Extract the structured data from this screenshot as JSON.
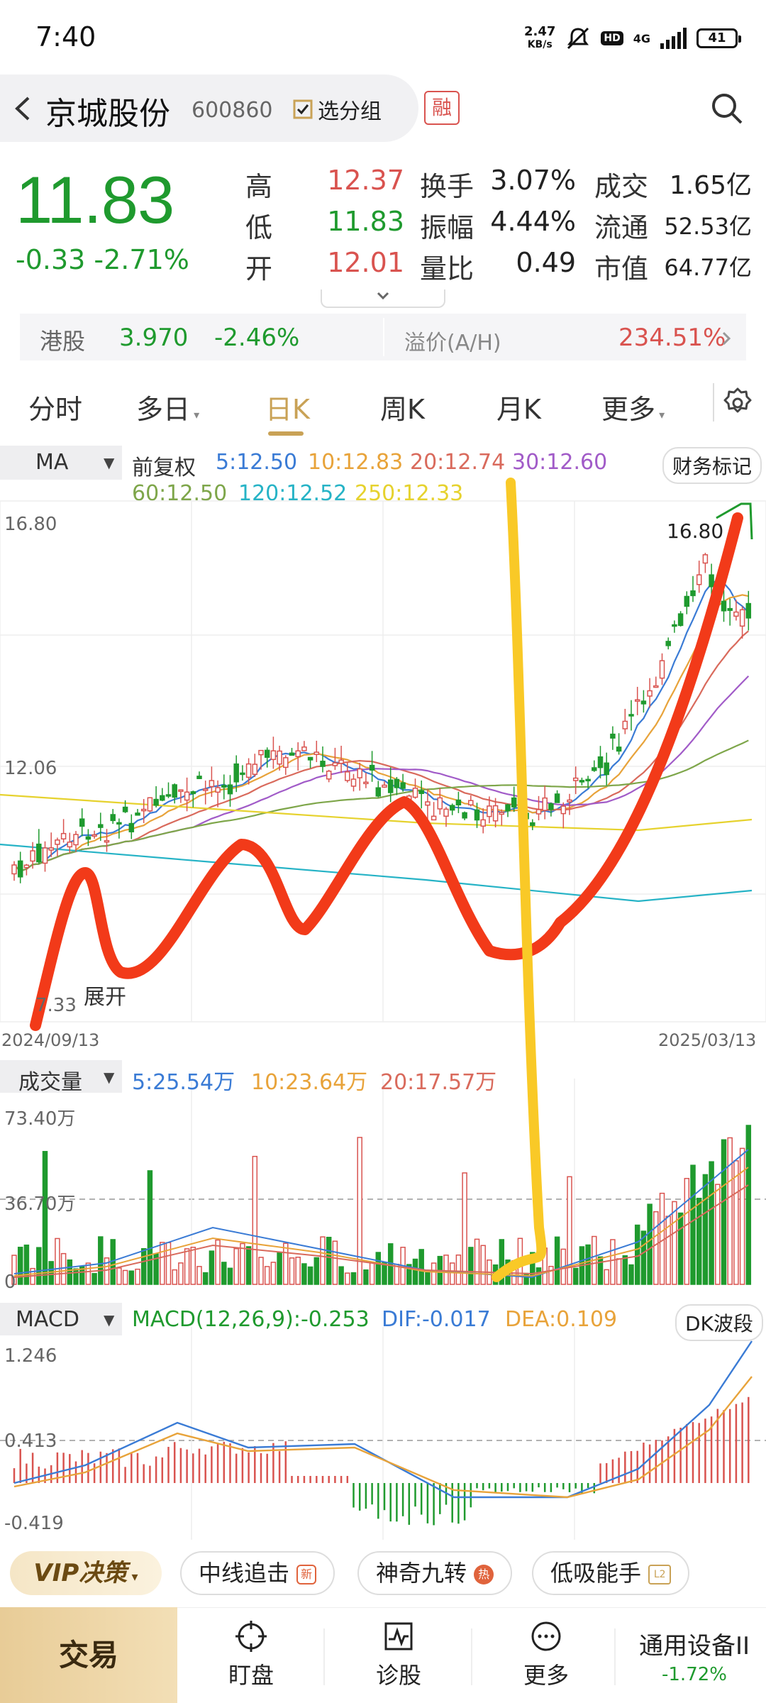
{
  "status_bar": {
    "time": "7:40",
    "net_speed_value": "2.47",
    "net_speed_unit": "KB/s",
    "network": "4G",
    "battery": "41"
  },
  "header": {
    "stock_name": "京城股份",
    "stock_code": "600860",
    "watch_label": "选分组",
    "margin_badge": "融"
  },
  "quote": {
    "price": "11.83",
    "change": "-0.33",
    "change_pct": "-2.71%",
    "high_label": "高",
    "high": "12.37",
    "low_label": "低",
    "low": "11.83",
    "open_label": "开",
    "open": "12.01",
    "turnover_label": "换手",
    "turnover": "3.07%",
    "amplitude_label": "振幅",
    "amplitude": "4.44%",
    "vol_ratio_label": "量比",
    "vol_ratio": "0.49",
    "amount_label": "成交",
    "amount": "1.65亿",
    "float_label": "流通",
    "float_cap": "52.53亿",
    "mktcap_label": "市值",
    "mktcap": "64.77亿"
  },
  "hk": {
    "label": "港股",
    "price": "3.970",
    "change_pct": "-2.46%",
    "premium_label": "溢价(A/H)",
    "premium": "234.51%"
  },
  "tabs": [
    {
      "label": "分时"
    },
    {
      "label": "多日"
    },
    {
      "label": "日K"
    },
    {
      "label": "周K"
    },
    {
      "label": "月K"
    },
    {
      "label": "更多"
    }
  ],
  "ma": {
    "selector": "MA",
    "adjust": "前复权",
    "ma5": "5:12.50",
    "ma10": "10:12.83",
    "ma20": "20:12.74",
    "ma30": "30:12.60",
    "ma60": "60:12.50",
    "ma120": "120:12.52",
    "ma250": "250:12.33",
    "side_button": "财务标记",
    "y_top": "16.80",
    "y_mid": "12.06",
    "y_low": "7.33",
    "peak_label": "16.80",
    "expand_label": "展开",
    "date_start": "2024/09/13",
    "date_end": "2025/03/13"
  },
  "volume": {
    "selector": "成交量",
    "v5": "5:25.54万",
    "v10": "10:23.64万",
    "v20": "20:17.57万",
    "y_top": "73.40万",
    "y_mid": "36.70万",
    "y_zero": "0"
  },
  "macd": {
    "selector": "MACD",
    "macd": "MACD(12,26,9):-0.253",
    "dif": "DIF:-0.017",
    "dea": "DEA:0.109",
    "side_button": "DK波段",
    "y_top": "1.246",
    "y_mid": "0.413",
    "y_low": "-0.419"
  },
  "strategy": {
    "vip": "VIP决策",
    "chip1": "中线追击",
    "chip2": "神奇九转",
    "chip3": "低吸能手"
  },
  "bottom_nav": {
    "trade": "交易",
    "watch": "盯盘",
    "diagnose": "诊股",
    "more": "更多",
    "sector": "通用设备II",
    "sector_change": "-1.72%"
  },
  "colors": {
    "up": "#d9534f",
    "down": "#1f9a2e",
    "accent": "#c9a256",
    "ma5": "#3a7bd5",
    "ma10": "#e8a33a",
    "ma20": "#d96a5c",
    "ma30": "#a15bc8",
    "ma60": "#7ea64a",
    "ma120": "#26b3c6",
    "ma250": "#e6d22e"
  }
}
